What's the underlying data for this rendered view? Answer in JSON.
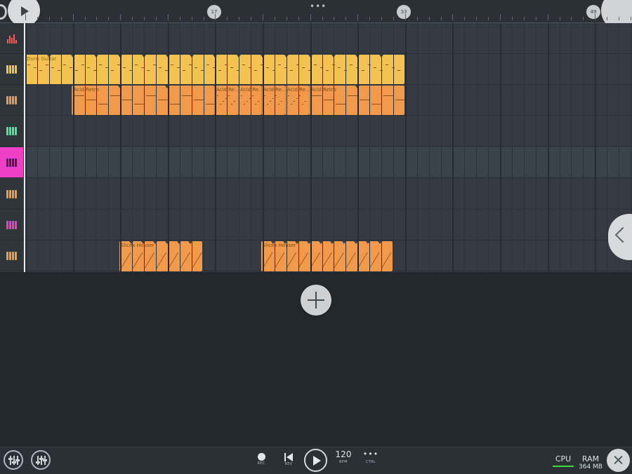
{
  "timeline": {
    "markers": [
      "17",
      "33",
      "49"
    ],
    "menu_dots": "•••"
  },
  "tracks": [
    {
      "icon": "levels-icon",
      "color": "#ff5b5b"
    },
    {
      "icon": "keys-icon",
      "color": "#f3c251"
    },
    {
      "icon": "keys-icon",
      "color": "#f19a4b"
    },
    {
      "icon": "keys-icon",
      "color": "#4fe3a0"
    },
    {
      "icon": "keys-icon",
      "color": "#3a2a35",
      "selected": true
    },
    {
      "icon": "keys-icon",
      "color": "#f19a4b"
    },
    {
      "icon": "keys-icon",
      "color": "#ee3fc6"
    },
    {
      "icon": "keys-icon",
      "color": "#f19a4b"
    }
  ],
  "clips": {
    "dunk_guitar": "Dunk Guitar",
    "acid_retro": "Acid Retro",
    "acid_short_1": "Acid Re...",
    "acid_short_2": "Acid Re...",
    "acid_short_3": "Acid Re...",
    "acid_short_4": "Acid Re...",
    "acid_retro_2": "Acid Retro",
    "slicex_1": "Slicex Houser",
    "slicex_2": "Slicex Houser"
  },
  "transport": {
    "rec_label": "REC",
    "rev_label": "REV",
    "bpm_value": "120",
    "bpm_label": "BPM",
    "ctrl_dots": "•••",
    "ctrl_label": "CTRL"
  },
  "status": {
    "cpu_label": "CPU",
    "ram_label": "RAM",
    "ram_value": "364 MB"
  },
  "colors": {
    "accent_pink": "#ee3fc6",
    "clip_yellow": "#f3c251",
    "clip_orange": "#f19a4b",
    "cpu_green": "#37e03b"
  }
}
